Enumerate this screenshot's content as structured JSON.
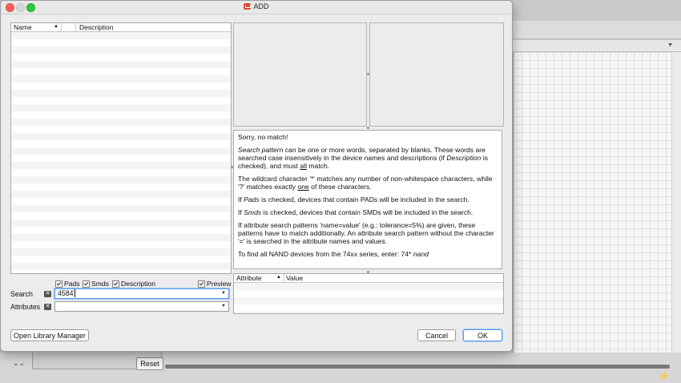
{
  "window": {
    "title": "ADD"
  },
  "device_table": {
    "columns": [
      "Name",
      "Description"
    ],
    "sort_indicator": "▲",
    "rows": []
  },
  "filters": {
    "pads": {
      "label": "Pads",
      "checked": true
    },
    "smds": {
      "label": "Smds",
      "checked": true
    },
    "description": {
      "label": "Description",
      "checked": true
    },
    "preview": {
      "label": "Preview",
      "checked": true
    }
  },
  "search": {
    "label": "Search",
    "value": "4584",
    "clear_icon": "clear-icon"
  },
  "attributes": {
    "label": "Attributes",
    "value": "",
    "clear_icon": "clear-icon"
  },
  "help": {
    "no_match": "Sorry, no match!",
    "p1_em": "Search pattern",
    "p1_a": " can be one or more words, separated by blanks. These words are searched case insensitively in the device names and descriptions (if ",
    "p1_em2": "Description",
    "p1_b": " is checked), and must ",
    "p1_u": "all",
    "p1_c": " match.",
    "p2_a": "The wildcard character '*' matches any number of non-whitespace characters, while '?' matches exactly ",
    "p2_u": "one",
    "p2_b": " of these characters.",
    "p3_a": "If ",
    "p3_em": "Pads",
    "p3_b": " is checked, devices that contain PADs will be included in the search.",
    "p4_a": "If ",
    "p4_em": "Smds",
    "p4_b": " is checked, devices that contain SMDs will be included in the search.",
    "p5": "If attribute search patterns 'name=value' (e.g.: tolerance=5%) are given, these patterns have to match additionally. An attribute search pattern without the character '=' is searched in the attribute names and values.",
    "p6_a": "To find all NAND devices from the 74xx series, enter: 74*  ",
    "p6_em": "nand"
  },
  "attribute_table": {
    "columns": [
      "Attribute",
      "Value"
    ],
    "sort_indicator": "▲",
    "rows": []
  },
  "buttons": {
    "open_library_manager": "Open Library Manager",
    "cancel": "Cancel",
    "ok": "OK"
  },
  "background": {
    "reset_label": "Reset"
  },
  "colors": {
    "accent": "#5a9bea",
    "close": "#fc5f57",
    "zoom": "#2dc840"
  }
}
